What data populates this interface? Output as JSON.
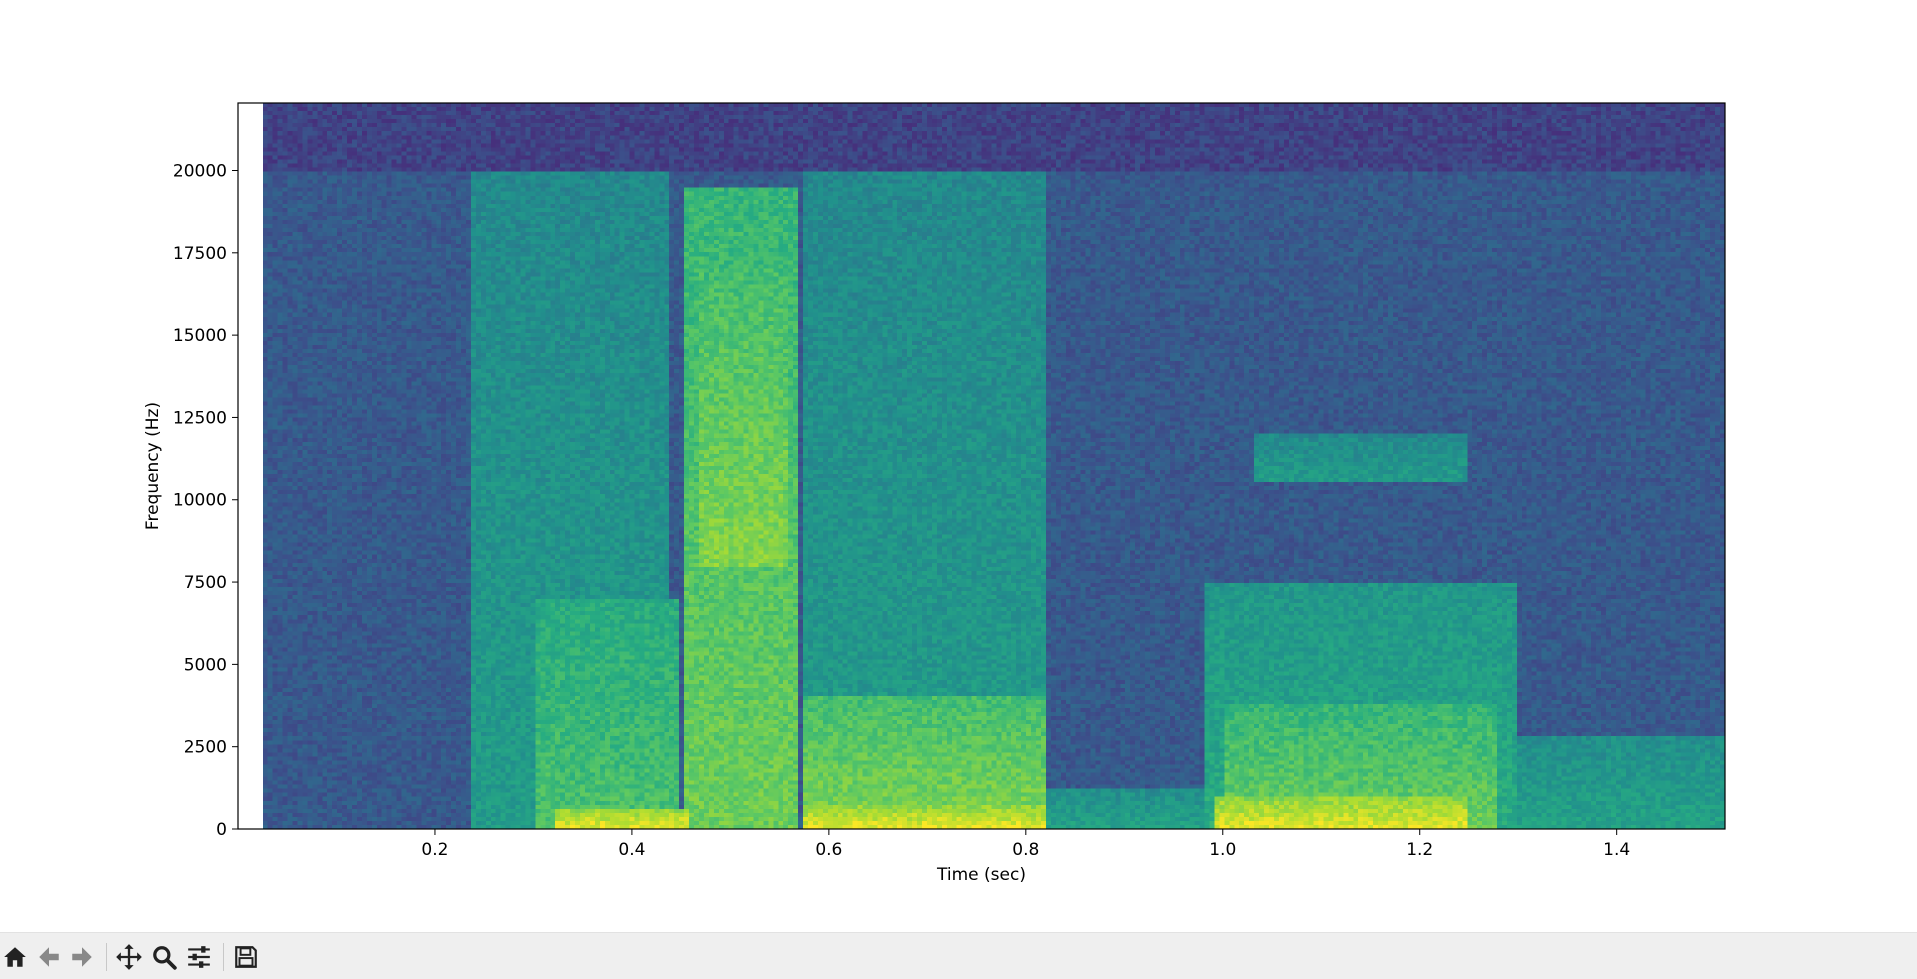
{
  "toolbar": {
    "buttons": [
      {
        "name": "home-button",
        "icon": "home-icon"
      },
      {
        "name": "back-button",
        "icon": "arrow-left-icon"
      },
      {
        "name": "forward-button",
        "icon": "arrow-right-icon"
      },
      {
        "name": "pan-button",
        "icon": "move-icon"
      },
      {
        "name": "zoom-button",
        "icon": "magnifier-icon"
      },
      {
        "name": "configure-subplots-button",
        "icon": "sliders-icon"
      },
      {
        "name": "save-button",
        "icon": "floppy-disk-icon"
      }
    ]
  },
  "chart_data": {
    "type": "heatmap",
    "title": "",
    "xlabel": "Time (sec)",
    "ylabel": "Frequency (Hz)",
    "xlim": [
      0.0,
      1.51
    ],
    "ylim": [
      0,
      22050
    ],
    "data_start_x": 0.025,
    "x_ticks": [
      0.2,
      0.4,
      0.6,
      0.8,
      1.0,
      1.2,
      1.4
    ],
    "x_tick_labels": [
      "0.2",
      "0.4",
      "0.6",
      "0.8",
      "1.0",
      "1.2",
      "1.4"
    ],
    "y_ticks": [
      0,
      2500,
      5000,
      7500,
      10000,
      12500,
      15000,
      17500,
      20000
    ],
    "y_tick_labels": [
      "0",
      "2500",
      "5000",
      "7500",
      "10000",
      "12500",
      "15000",
      "17500",
      "20000"
    ],
    "colormap": "viridis",
    "grid": false,
    "energy_regions": [
      {
        "t": [
          0.235,
          0.44
        ],
        "f": [
          0,
          20000
        ],
        "intensity": 0.55
      },
      {
        "t": [
          0.3,
          0.45
        ],
        "f": [
          0,
          7000
        ],
        "intensity": 0.72
      },
      {
        "t": [
          0.32,
          0.46
        ],
        "f": [
          0,
          600
        ],
        "intensity": 0.98
      },
      {
        "t": [
          0.455,
          0.57
        ],
        "f": [
          0,
          19500
        ],
        "intensity": 0.78
      },
      {
        "t": [
          0.47,
          0.56
        ],
        "f": [
          8000,
          17000
        ],
        "intensity": 0.82
      },
      {
        "t": [
          0.575,
          0.82
        ],
        "f": [
          0,
          20000
        ],
        "intensity": 0.55
      },
      {
        "t": [
          0.575,
          0.82
        ],
        "f": [
          0,
          4000
        ],
        "intensity": 0.82
      },
      {
        "t": [
          0.575,
          0.82
        ],
        "f": [
          0,
          700
        ],
        "intensity": 0.98
      },
      {
        "t": [
          0.82,
          0.98
        ],
        "f": [
          0,
          1200
        ],
        "intensity": 0.58
      },
      {
        "t": [
          0.98,
          1.3
        ],
        "f": [
          0,
          7500
        ],
        "intensity": 0.62
      },
      {
        "t": [
          1.0,
          1.28
        ],
        "f": [
          0,
          3800
        ],
        "intensity": 0.78
      },
      {
        "t": [
          0.99,
          1.25
        ],
        "f": [
          0,
          1000
        ],
        "intensity": 0.97
      },
      {
        "t": [
          1.03,
          1.25
        ],
        "f": [
          10500,
          12000
        ],
        "intensity": 0.55
      },
      {
        "t": [
          1.3,
          1.51
        ],
        "f": [
          0,
          2800
        ],
        "intensity": 0.58
      }
    ]
  }
}
